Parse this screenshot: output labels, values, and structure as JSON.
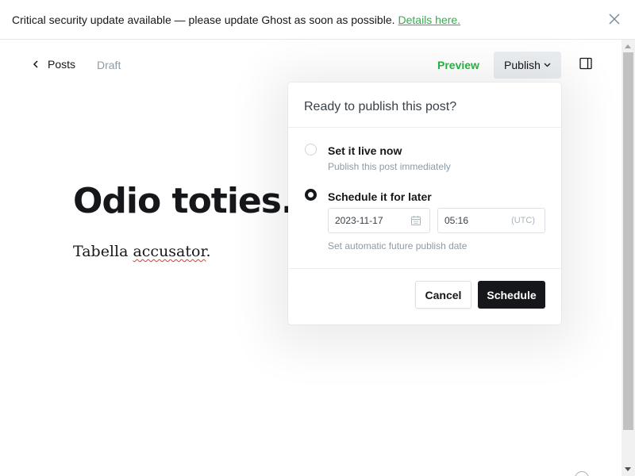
{
  "banner": {
    "message": "Critical security update available — please update Ghost as soon as possible.",
    "link_text": "Details here."
  },
  "header": {
    "back_label": "Posts",
    "status": "Draft",
    "preview_label": "Preview",
    "publish_label": "Publish"
  },
  "post": {
    "title": "Odio toties.",
    "body_prefix": "Tabella ",
    "body_misspelled": "accusator",
    "body_suffix": "."
  },
  "publish_menu": {
    "title": "Ready to publish this post?",
    "options": [
      {
        "label": "Set it live now",
        "description": "Publish this post immediately",
        "selected": false
      },
      {
        "label": "Schedule it for later",
        "description": "Set automatic future publish date",
        "selected": true
      }
    ],
    "date_value": "2023-11-17",
    "time_value": "05:16",
    "timezone": "(UTC)",
    "cancel_label": "Cancel",
    "schedule_label": "Schedule"
  },
  "colors": {
    "accent_green": "#30b04a",
    "dark": "#15171a",
    "muted": "#8e9aa3"
  }
}
